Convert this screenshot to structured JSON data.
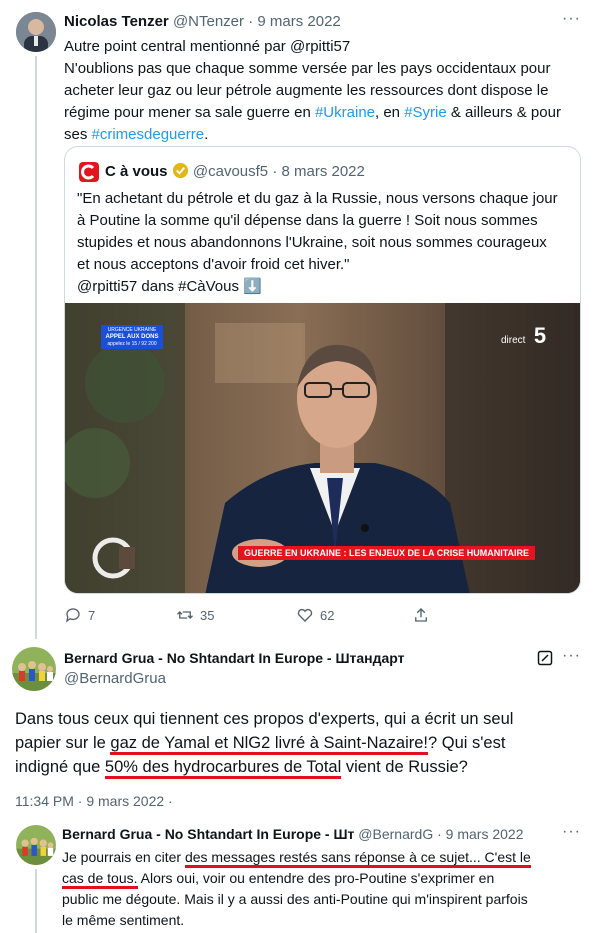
{
  "tweet1": {
    "name": "Nicolas Tenzer",
    "handle": "@NTenzer",
    "sep": "·",
    "date": "9 mars 2022",
    "line1": "Autre point central mentionné par @rpitti57",
    "line2": "N'oublions pas que chaque somme versée par les pays occidentaux pour",
    "line3": "acheter leur gaz ou leur pétrole augmente les ressources dont dispose le",
    "line4a": "régime pour mener sa sale guerre en ",
    "tag_ukraine": "#Ukraine",
    "line4b": ", en ",
    "tag_syrie": "#Syrie",
    "line4c": " & ailleurs & pour",
    "line5a": "ses ",
    "tag_crimes": "#crimesdeguerre",
    "line5b": ".",
    "quote": {
      "name": "C à vous",
      "handle": "@cavousf5",
      "sep": "·",
      "date": "8 mars 2022",
      "text1": "\"En achetant du pétrole et du gaz à la Russie, nous versons chaque jour",
      "text2": "à Poutine la somme qu'il dépense dans la guerre ! Soit nous sommes",
      "text3": "stupides et nous abandonnons l'Ukraine, soit nous sommes courageux",
      "text4": "et nous acceptons d'avoir froid cet hiver.\"",
      "text5": "@rpitti57 dans #CàVous ⬇️",
      "video": {
        "badge_line1": "URGENCE UKRAINE",
        "badge_line2": "APPEL AUX DONS",
        "badge_line3": "appelez le 15 / 92 200",
        "channel": "direct",
        "channel_num": "5",
        "banner": "GUERRE EN UKRAINE : LES ENJEUX DE LA CRISE HUMANITAIRE"
      }
    },
    "actions": {
      "replies": "7",
      "retweets": "35",
      "likes": "62"
    }
  },
  "tweet2": {
    "name": "Bernard Grua - No Shtandart In Europe - Штандарт",
    "handle": "@BernardGrua",
    "t1": "Dans tous ceux qui tiennent ces propos d'experts, qui a écrit un seul",
    "t2a": "papier sur le ",
    "t2u": "gaz de Yamal et NlG2 livré à Saint-Nazaire!",
    "t2b": "? Qui s'est",
    "t3a": "indigné que ",
    "t3u": "50% des hydrocarbures de Total",
    "t3b": " vient de Russie?",
    "timestamp": "11:34 PM · 9 mars 2022 ·"
  },
  "tweet3": {
    "name": "Bernard Grua - No Shtandart In Europe - Шт",
    "handle": "@BernardG",
    "sep": "·",
    "date": "9 mars 2022",
    "l1a": "Je pourrais en citer ",
    "l1u": "des messages restés sans réponse à ce sujet... C'est le",
    "l2u": "cas de tous.",
    "l2b": " Alors oui, voir ou entendre des pro-Poutine s'exprimer en",
    "l3": "public me dégoute. Mais il y a aussi des anti-Poutine qui m'inspirent parfois",
    "l4": "le même sentiment."
  },
  "colors": {
    "link": "#1d9bf0",
    "muted": "#536471",
    "underline": "#e0101f",
    "banner": "#e4141f"
  }
}
